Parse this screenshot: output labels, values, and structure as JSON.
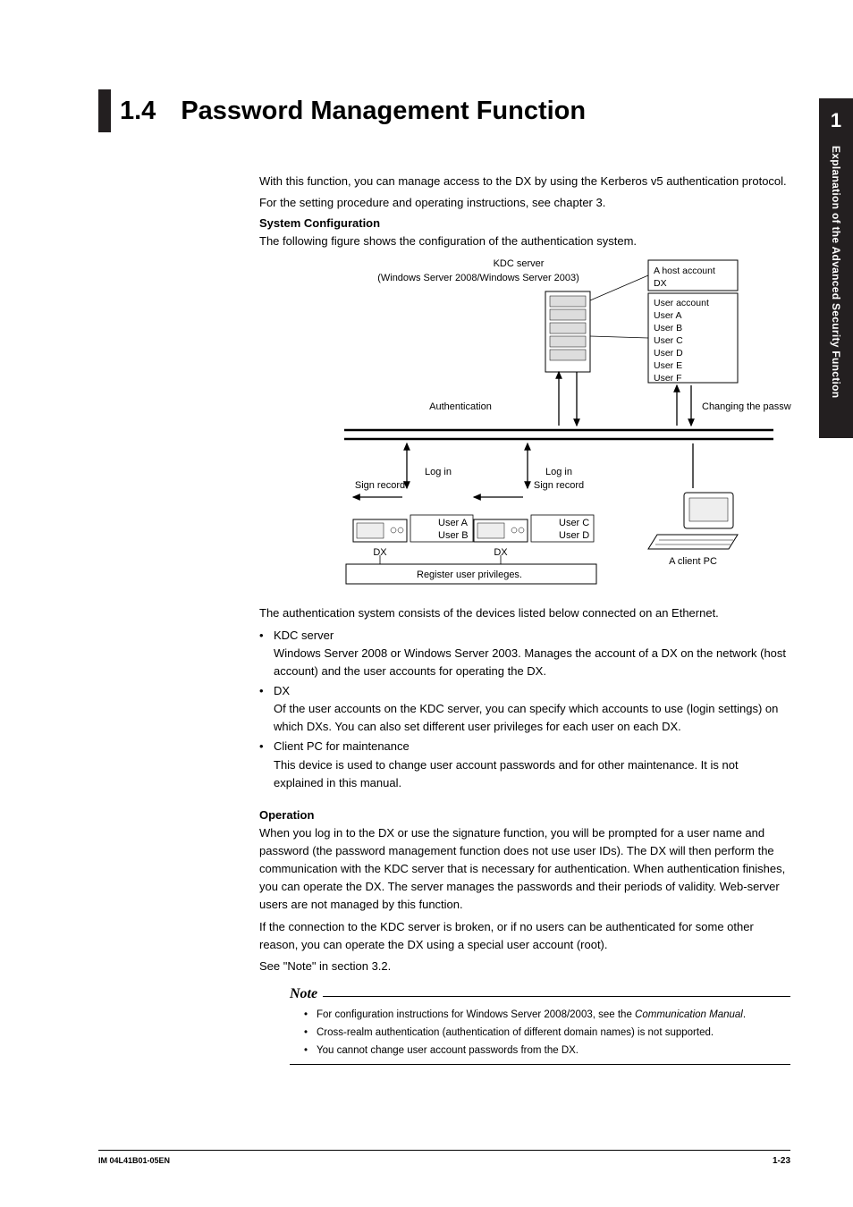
{
  "chapter": {
    "number": "1",
    "title": "Explanation of the Advanced Security Function"
  },
  "heading": {
    "number": "1.4",
    "text": "Password Management Function"
  },
  "intro": {
    "p1": "With this function, you can manage access to the DX by using the Kerberos v5 authentication protocol.",
    "p2": "For the setting procedure and operating instructions, see chapter 3."
  },
  "sysconf": {
    "title": "System Configuration",
    "lead": "The following figure shows the configuration of the authentication system."
  },
  "diagram": {
    "kdc_server": "KDC server",
    "kdc_sub": "(Windows Server 2008/Windows Server 2003)",
    "host_account": "A host account",
    "dx": "DX",
    "user_account": "User account",
    "users": [
      "User A",
      "User B",
      "User C",
      "User D",
      "User E",
      "User F"
    ],
    "authentication": "Authentication",
    "changing_password": "Changing the password",
    "log_in": "Log in",
    "sign_record": "Sign record",
    "user_a": "User A",
    "user_b": "User B",
    "user_c": "User C",
    "user_d": "User D",
    "dx_label": "DX",
    "client_pc": "A client PC",
    "register": "Register user privileges."
  },
  "auth_system": {
    "lead": "The authentication system consists of the devices listed below connected on an Ethernet.",
    "b1_title": "KDC server",
    "b1_body": "Windows Server 2008 or Windows Server 2003. Manages the account of a DX on the network (host account) and the user accounts for operating the DX.",
    "b2_title": "DX",
    "b2_body": "Of the user accounts on the KDC server, you can specify which accounts to use (login settings) on which DXs. You can also set different user privileges for each user on each DX.",
    "b3_title": "Client PC for maintenance",
    "b3_body": "This device is used to change user account passwords and for other maintenance. It is not explained in this manual."
  },
  "operation": {
    "title": "Operation",
    "p1": "When you log in to the DX or use the signature function, you will be prompted for a user name and password (the password management function does not use user IDs). The DX will then perform the communication with the KDC server that is necessary for authentication. When authentication finishes, you can operate the DX. The server manages the passwords and their periods of validity. Web-server users are not managed by this function.",
    "p2": "If the connection to the KDC server is broken, or if no users can be authenticated for some other reason, you can operate the DX using a special user account (root).",
    "p3": "See \"Note\" in section 3.2."
  },
  "note": {
    "label": "Note",
    "b1_prefix": "For configuration instructions for Windows Server 2008/2003, see the ",
    "b1_italic": "Communication Manual",
    "b1_suffix": ".",
    "b2": "Cross-realm authentication (authentication of different domain names) is not supported.",
    "b3": "You cannot change user account passwords from the DX."
  },
  "footer": {
    "left": "IM 04L41B01-05EN",
    "right": "1-23"
  }
}
